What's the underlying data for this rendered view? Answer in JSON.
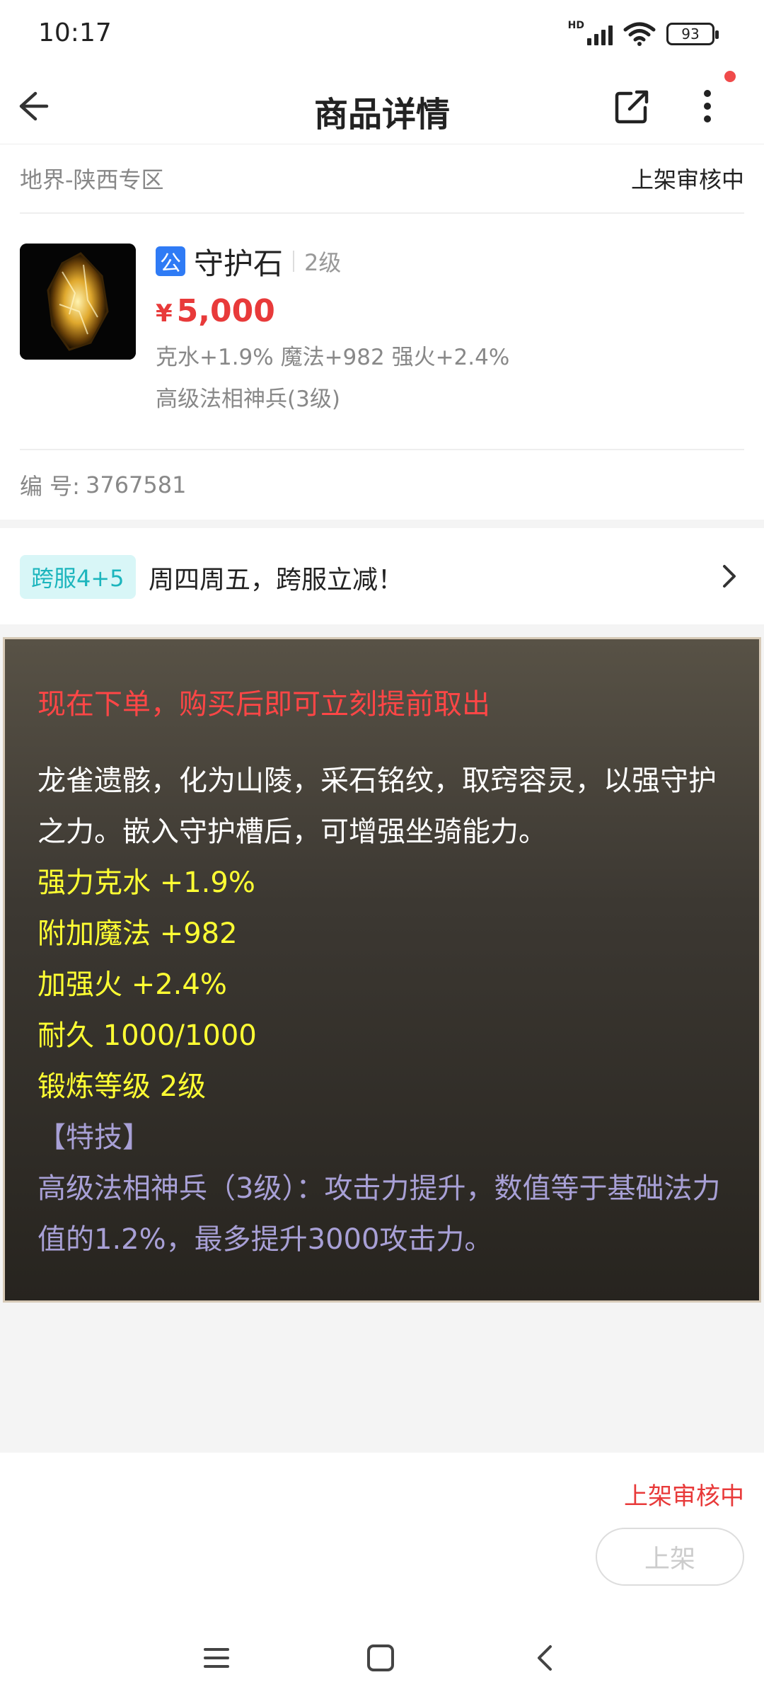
{
  "status_bar": {
    "time": "10:17",
    "network_label": "HD",
    "battery": "93"
  },
  "header": {
    "title": "商品详情",
    "notification_dot_color": "#f04a4a"
  },
  "listing": {
    "zone": "地界-陕西专区",
    "status": "上架审核中",
    "item": {
      "badge": "公",
      "name": "守护石",
      "level": "2级",
      "currency": "¥",
      "price": "5,000",
      "attributes": "克水+1.9% 魔法+982 强火+2.4%",
      "skill": "高级法相神兵(3级)"
    },
    "id_label": "编 号:",
    "id_value": "3767581"
  },
  "promo": {
    "tag": "跨服4+5",
    "text": "周四周五，跨服立减！"
  },
  "description": {
    "notice": "现在下单，购买后即可立刻提前取出",
    "lore": "龙雀遗骸，化为山陵，采石铭纹，取窍容灵，以强守护之力。嵌入守护槽后，可增强坐骑能力。",
    "stats": [
      "强力克水 +1.9%",
      "附加魔法 +982",
      "加强火 +2.4%",
      "耐久 1000/1000",
      "锻炼等级 2级"
    ],
    "special_header": "【特技】",
    "special_text": "高级法相神兵（3级）：攻击力提升，数值等于基础法力值的1.2%，最多提升3000攻击力。"
  },
  "footer": {
    "status": "上架审核中",
    "list_button": "上架"
  },
  "colors": {
    "price_red": "#e83a3a",
    "badge_blue": "#2f7bf5",
    "promo_tag_bg": "#d8f6f7",
    "promo_tag_text": "#1cb5bd",
    "stat_yellow": "#ffff33",
    "special_purple": "#a8a0d6"
  }
}
